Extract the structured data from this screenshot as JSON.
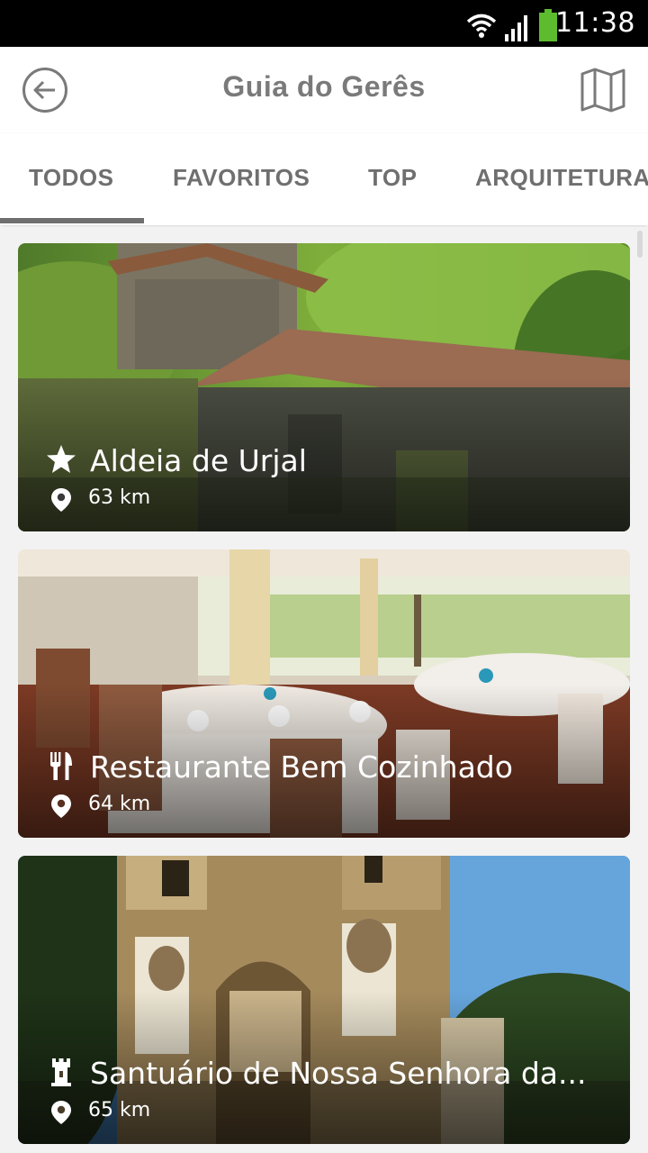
{
  "status_bar": {
    "time": "11:38",
    "icons": [
      "wifi-icon",
      "signal-icon",
      "battery-icon"
    ],
    "battery_color": "#5dbb2e"
  },
  "app_bar": {
    "title": "Guia do Gerês",
    "back_icon": "arrow-left-circle-icon",
    "map_icon": "map-icon"
  },
  "tabs": [
    {
      "label": "TODOS",
      "active": true
    },
    {
      "label": "FAVORITOS",
      "active": false
    },
    {
      "label": "TOP",
      "active": false
    },
    {
      "label": "ARQUITETURA",
      "active": false
    }
  ],
  "cards": [
    {
      "title": "Aldeia de Urjal",
      "distance": "63 km",
      "category_icon": "star-icon",
      "image_subject": "stone-house-forest"
    },
    {
      "title": "Restaurante Bem Cozinhado",
      "distance": "64 km",
      "category_icon": "fork-knife-icon",
      "image_subject": "restaurant-dining-room"
    },
    {
      "title": "Santuário de Nossa Senhora da...",
      "distance": "65 km",
      "category_icon": "tower-icon",
      "image_subject": "sanctuary-facade"
    }
  ],
  "colors": {
    "tab_text": "#6f6f6f",
    "title_text": "#7a7a7a",
    "content_bg": "#f2f2f2"
  }
}
